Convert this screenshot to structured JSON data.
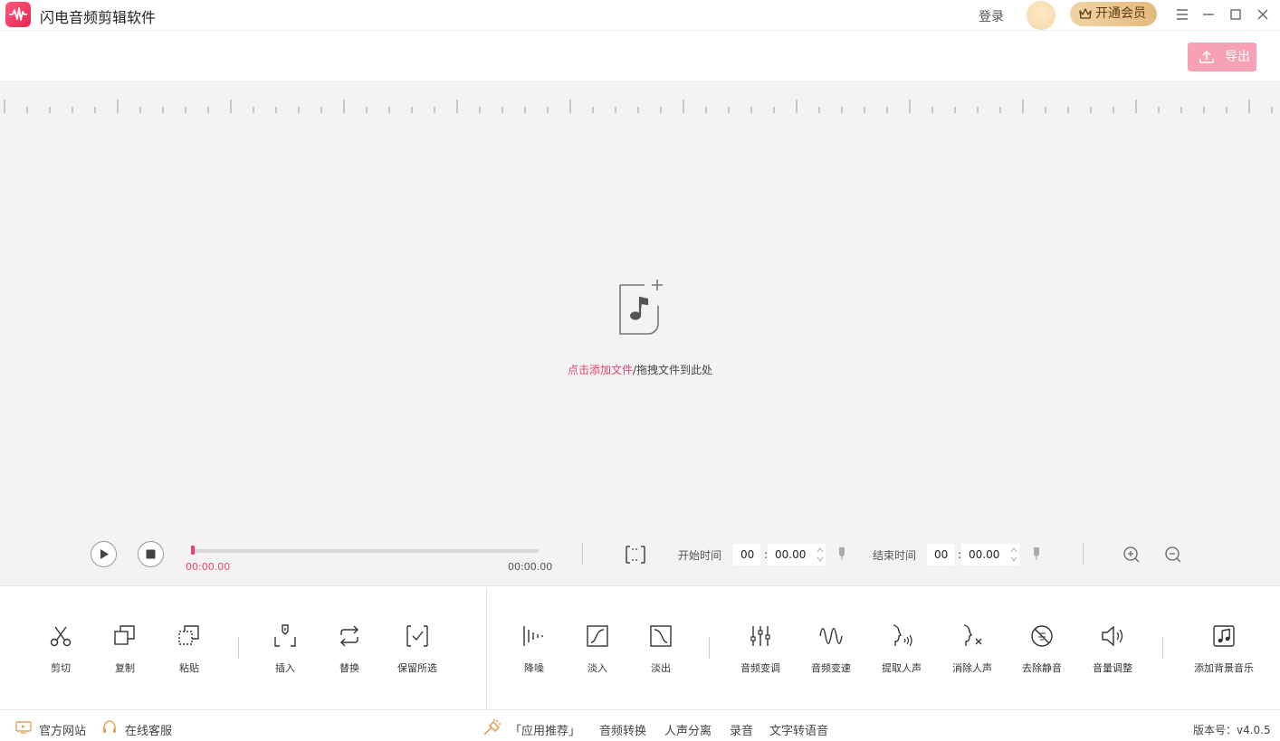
{
  "app": {
    "title": "闪电音频剪辑软件",
    "login_label": "登录",
    "vip_label": "开通会员",
    "accent_color": "#e8446d"
  },
  "header": {
    "export_label": "导出"
  },
  "drop_area": {
    "add_link": "点击添加文件",
    "drag_hint": "/拖拽文件到此处"
  },
  "playback": {
    "current_time": "00:00.00",
    "total_time": "00:00.00",
    "progress": 0,
    "start_label": "开始时间",
    "start_min": "00",
    "start_sec": "00.00",
    "end_label": "结束时间",
    "end_min": "00",
    "end_sec": "00.00",
    "colon": ":"
  },
  "toolbar": {
    "edit_tools": [
      {
        "label": "剪切",
        "icon": "scissors-icon"
      },
      {
        "label": "复制",
        "icon": "copy-icon"
      },
      {
        "label": "粘贴",
        "icon": "paste-icon"
      },
      {
        "label": "插入",
        "icon": "insert-icon"
      },
      {
        "label": "替换",
        "icon": "replace-icon"
      },
      {
        "label": "保留所选",
        "icon": "keep-selection-icon"
      }
    ],
    "effect_tools": [
      {
        "label": "降噪",
        "icon": "denoise-icon"
      },
      {
        "label": "淡入",
        "icon": "fade-in-icon"
      },
      {
        "label": "淡出",
        "icon": "fade-out-icon"
      },
      {
        "label": "音频变调",
        "icon": "pitch-icon"
      },
      {
        "label": "音频变速",
        "icon": "speed-icon"
      },
      {
        "label": "提取人声",
        "icon": "extract-voice-icon"
      },
      {
        "label": "消除人声",
        "icon": "remove-voice-icon"
      },
      {
        "label": "去除静音",
        "icon": "remove-silence-icon"
      },
      {
        "label": "音量调整",
        "icon": "volume-icon"
      },
      {
        "label": "添加背景音乐",
        "icon": "add-music-icon"
      }
    ]
  },
  "footer": {
    "website_label": "官方网站",
    "support_label": "在线客服",
    "recommend_label": "「应用推荐」",
    "links": [
      "音频转换",
      "人声分离",
      "录音",
      "文字转语音"
    ],
    "version_label": "版本号：v4.0.5"
  }
}
